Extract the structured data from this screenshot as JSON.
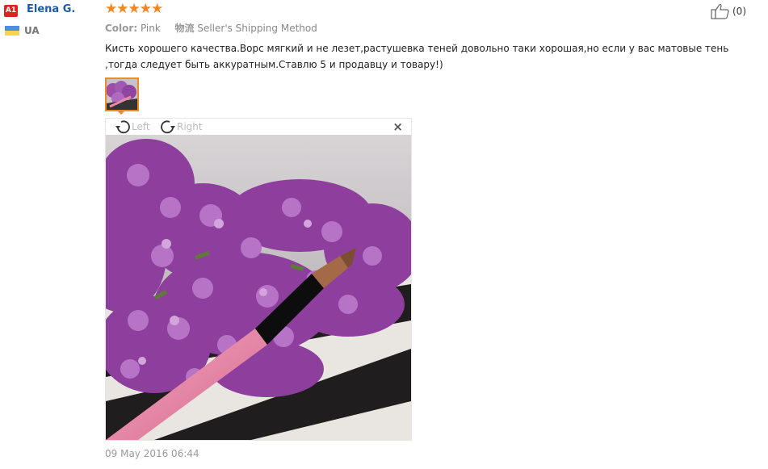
{
  "reviewer": {
    "level": "A1",
    "name": "Elena G.",
    "country": "UA"
  },
  "rating": {
    "stars": "★★★★★",
    "value": 5,
    "color": "#f5861f"
  },
  "sku": {
    "color_label": "Color:",
    "color_value": "Pink",
    "shipping_label": "物流",
    "shipping_value": "Seller's Shipping Method"
  },
  "review": {
    "text": "Кисть хорошего качества.Ворс мягкий и не лезет,растушевка теней довольно таки хорошая,но если у вас матовые тень ,тогда следует быть аккуратным.Ставлю 5 и продавцу и товару!)",
    "date": "09 May 2016 06:44"
  },
  "helpful": {
    "count": "(0)",
    "icon": "thumbs-up-icon"
  },
  "viewer": {
    "rotate_left": "Left",
    "rotate_right": "Right",
    "close": "×"
  },
  "colors": {
    "accent": "#f08a24",
    "name": "#1f5ca8",
    "badge": "#d9251c"
  }
}
